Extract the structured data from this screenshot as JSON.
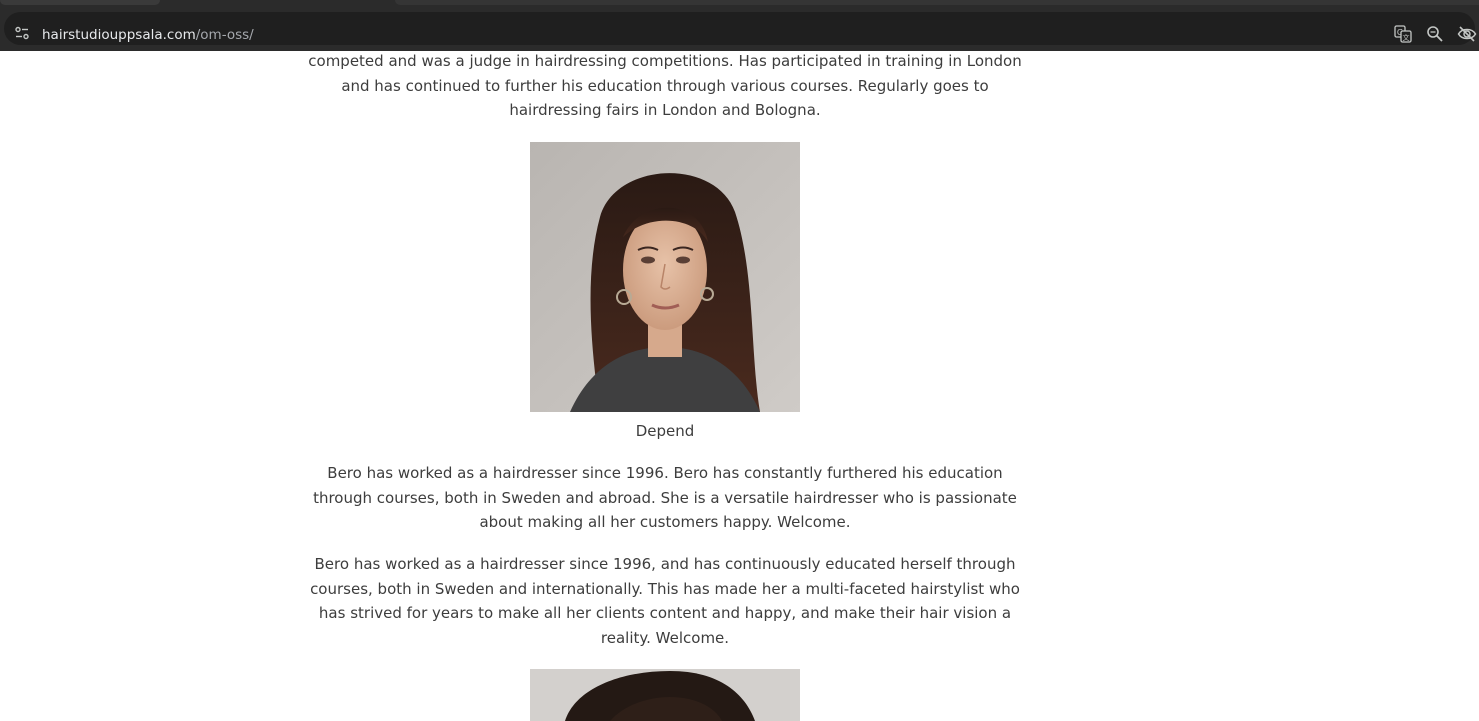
{
  "browser": {
    "url_domain": "hairstudiouppsala.com",
    "url_path": "/om-oss/",
    "icons": [
      "site-info-icon",
      "translate-icon",
      "zoom-icon",
      "eye-off-icon"
    ]
  },
  "page": {
    "intro_text": "competed and was a judge in hairdressing competitions. Has participated in training in London and has continued to further his education through various courses. Regularly goes to hairdressing fairs in London and Bologna.",
    "staff": [
      {
        "caption": "Depend",
        "bio_1": "Bero has worked as a hairdresser since 1996. Bero has constantly furthered his education through courses, both in Sweden and abroad. She is a versatile hairdresser who is passionate about making all her customers happy. Welcome.",
        "bio_2": "Bero has worked as a hairdresser since 1996, and has continuously educated herself through courses, both in Sweden and internationally. This has made her a multi-faceted hairstylist who has strived for years to make all her clients content and happy, and make their hair vision a reality. Welcome."
      }
    ]
  }
}
